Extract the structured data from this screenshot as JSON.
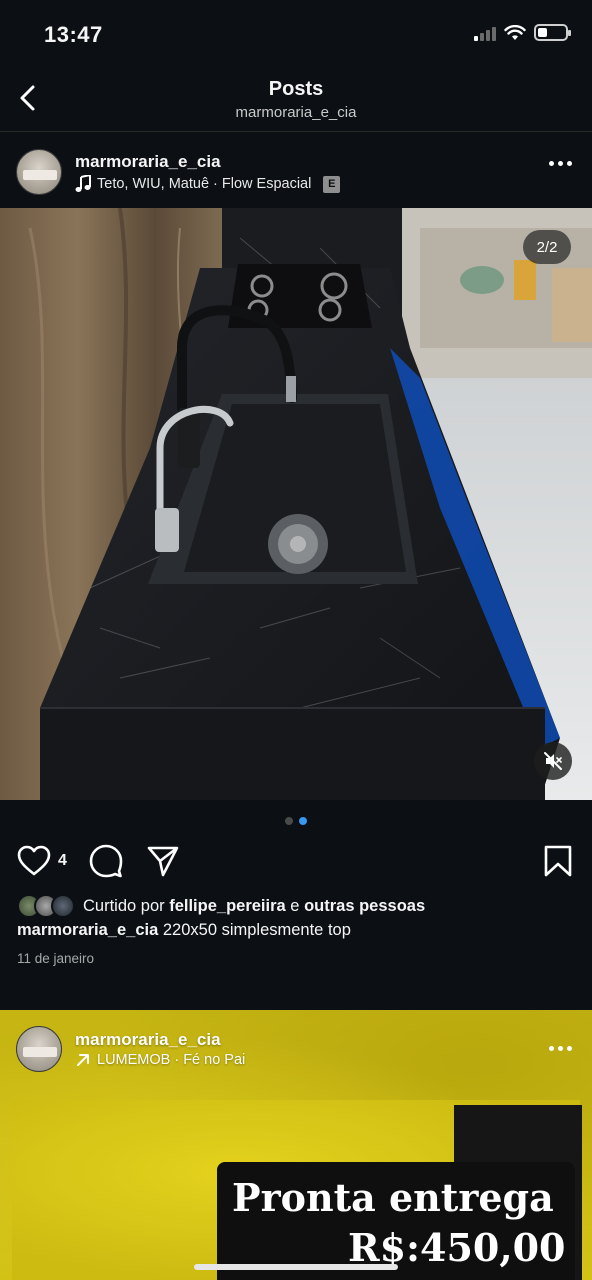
{
  "status_bar": {
    "time": "13:47"
  },
  "header": {
    "title": "Posts",
    "subtitle": "marmoraria_e_cia"
  },
  "post1": {
    "username": "marmoraria_e_cia",
    "audio": "Teto, WIU, Matuê · Flow Espacial",
    "explicit_badge": "E",
    "carousel_count": "2/2",
    "like_count": "4",
    "liked_by_prefix": "Curtido por",
    "liked_by_user": "fellipe_pereiira",
    "liked_by_conj": "e",
    "liked_by_others": "outras pessoas",
    "caption_user": "marmoraria_e_cia",
    "caption_text": "220x50 simplesmente top",
    "date": "11 de janeiro",
    "icons": [
      "heart-icon",
      "comment-icon",
      "share-icon",
      "bookmark-icon",
      "muted-speaker-icon",
      "music-note-icon"
    ]
  },
  "post2": {
    "username": "marmoraria_e_cia",
    "audio": "LUMEMOB · Fé no Pai",
    "price_line1": "Pronta entrega",
    "price_line2": "R$:450,00",
    "icons": [
      "arrow-up-right-icon"
    ]
  },
  "colors": {
    "background": "#0c1014",
    "accent": "#3897f0",
    "post2_yellow": "#c8b814"
  }
}
